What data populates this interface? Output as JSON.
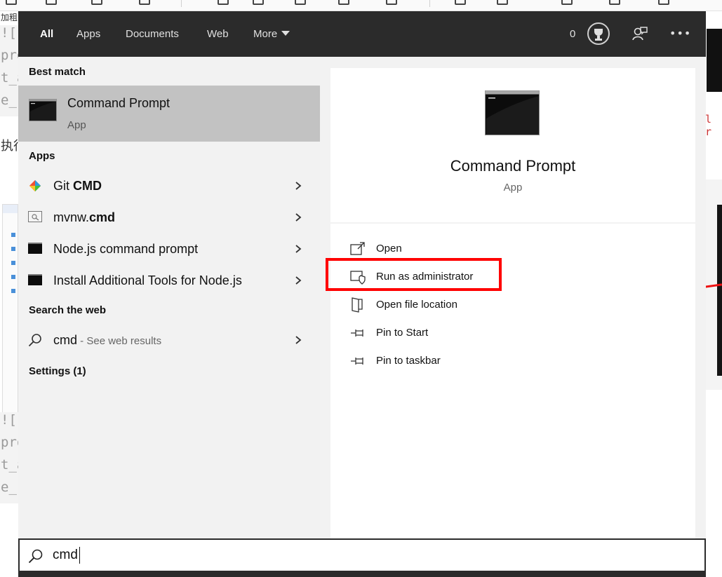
{
  "tabs": [
    {
      "label": "All"
    },
    {
      "label": "Apps"
    },
    {
      "label": "Documents"
    },
    {
      "label": "Web"
    },
    {
      "label": "More"
    }
  ],
  "header": {
    "points": "0"
  },
  "best_match": {
    "section_label": "Best match",
    "title": "Command Prompt",
    "subtitle": "App"
  },
  "apps_section": {
    "label": "Apps",
    "items": [
      {
        "prefix": "Git ",
        "bold": "CMD",
        "icon": "git-icon"
      },
      {
        "prefix": "mvnw.",
        "bold": "cmd",
        "icon": "script-file-icon"
      },
      {
        "prefix": "Node.js command prompt",
        "bold": "",
        "icon": "console-icon"
      },
      {
        "prefix": "Install Additional Tools for Node.js",
        "bold": "",
        "icon": "console-icon"
      }
    ]
  },
  "web_section": {
    "label": "Search the web",
    "query": "cmd",
    "hint": " - See web results"
  },
  "settings_section": {
    "label": "Settings (1)"
  },
  "preview": {
    "title": "Command Prompt",
    "subtitle": "App"
  },
  "actions": [
    {
      "label": "Open",
      "icon": "open-icon"
    },
    {
      "label": "Run as administrator",
      "icon": "shield-icon"
    },
    {
      "label": "Open file location",
      "icon": "file-location-icon"
    },
    {
      "label": "Pin to Start",
      "icon": "pin-icon"
    },
    {
      "label": "Pin to taskbar",
      "icon": "pin-icon"
    }
  ],
  "search": {
    "value": "cmd"
  },
  "background_fragments": {
    "toolbar_text": "加粗",
    "side_text": "执行",
    "code_lines": [
      "![](",
      "pro",
      "t_a",
      "e_"
    ],
    "right_code": "l r"
  },
  "colors": {
    "top_bar": "#2b2b2b",
    "panel": "#f2f2f2",
    "selected": "#c2c2c2",
    "highlight": "#ff0000"
  }
}
